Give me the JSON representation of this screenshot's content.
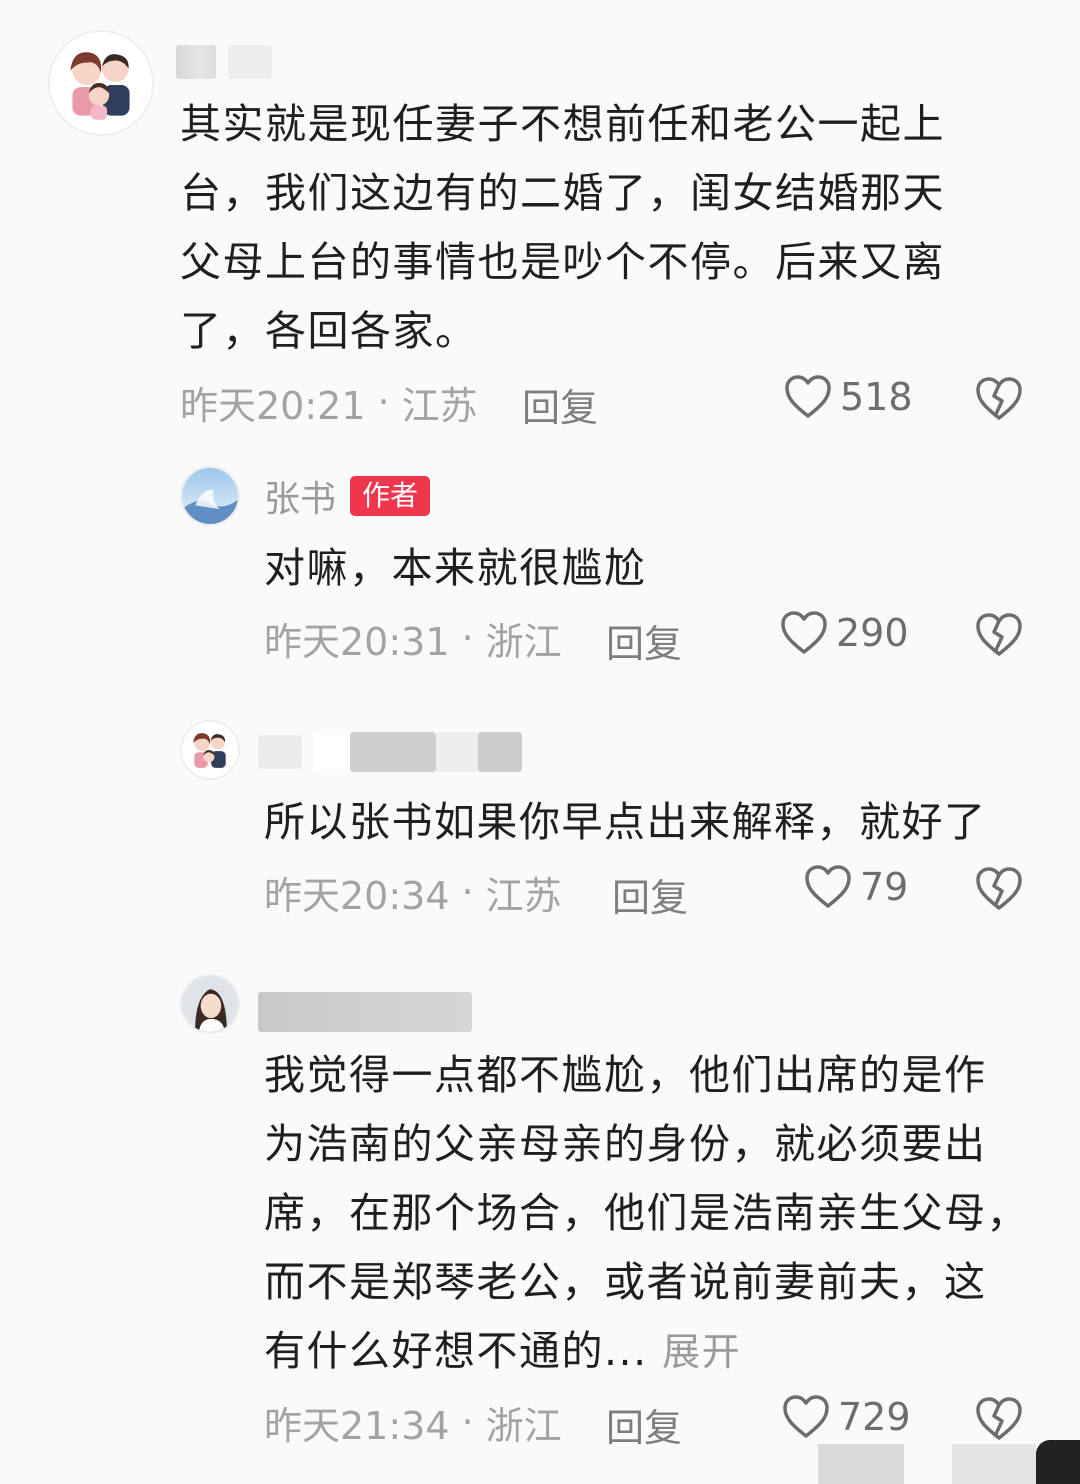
{
  "comments": [
    {
      "username": "",
      "is_author": false,
      "text": "其实就是现任妻子不想前任和老公一起上\n台，我们这边有的二婚了，闺女结婚那天\n父母上台的事情也是吵个不停。后来又离\n了，各回各家。",
      "time": "昨天20:21",
      "location": "江苏",
      "reply_label": "回复",
      "likes": "518"
    },
    {
      "username": "张书",
      "is_author": true,
      "author_badge": "作者",
      "text": "对嘛，本来就很尴尬",
      "time": "昨天20:31",
      "location": "浙江",
      "reply_label": "回复",
      "likes": "290"
    },
    {
      "username": "",
      "is_author": false,
      "text": "所以张书如果你早点出来解释，就好了",
      "time": "昨天20:34",
      "location": "江苏",
      "reply_label": "回复",
      "likes": "79"
    },
    {
      "username": "",
      "is_author": false,
      "text": "我觉得一点都不尴尬，他们出席的是作\n为浩南的父亲母亲的身份，就必须要出\n席，在那个场合，他们是浩南亲生父母，\n而不是郑琴老公，或者说前妻前夫，这\n有什么好想不通的...",
      "expand_label": "展开",
      "time": "昨天21:34",
      "location": "浙江",
      "reply_label": "回复",
      "likes": "729"
    }
  ],
  "separator": "·",
  "icons": {
    "like": "heart-outline-icon",
    "dislike": "broken-heart-icon"
  },
  "colors": {
    "author_badge": "#f0364c",
    "meta_text": "#a3a3a3",
    "body_text": "#1f1f1f"
  }
}
